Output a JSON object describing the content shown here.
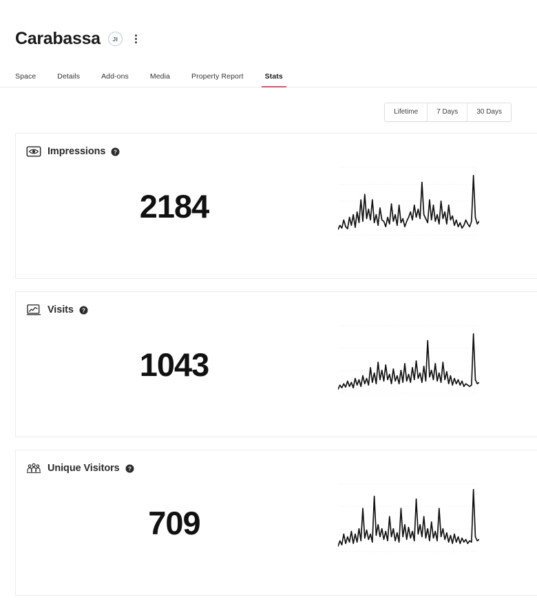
{
  "header": {
    "title": "Carabassa",
    "avatar_initials": "JI",
    "menu_icon": "kebab-menu-icon"
  },
  "tabs": [
    {
      "label": "Space",
      "active": false
    },
    {
      "label": "Details",
      "active": false
    },
    {
      "label": "Add-ons",
      "active": false
    },
    {
      "label": "Media",
      "active": false
    },
    {
      "label": "Property Report",
      "active": false
    },
    {
      "label": "Stats",
      "active": true
    }
  ],
  "range_selector": {
    "options": [
      "Lifetime",
      "7 Days",
      "30 Days"
    ],
    "selected": "Lifetime"
  },
  "colors": {
    "accent": "#d6546b",
    "avatar_border": "#b9c6e8",
    "text": "#1b1b1b",
    "card_border": "#ececec",
    "spark_line": "#111111",
    "gridline": "#eceef2"
  },
  "cards": [
    {
      "label": "Impressions",
      "icon": "impressions-eye-icon",
      "help_icon": "help-circle-icon",
      "value": "2184",
      "chart_data": {
        "type": "line",
        "title": "Impressions",
        "xlabel": "",
        "ylabel": "",
        "grid": true,
        "gridlines": 4,
        "ylim": [
          0,
          100
        ],
        "values": [
          8,
          14,
          10,
          22,
          12,
          9,
          26,
          14,
          30,
          11,
          34,
          18,
          52,
          20,
          60,
          24,
          38,
          22,
          52,
          18,
          30,
          14,
          40,
          22,
          20,
          12,
          26,
          16,
          46,
          20,
          30,
          14,
          44,
          18,
          24,
          12,
          20,
          26,
          34,
          22,
          44,
          26,
          38,
          24,
          78,
          30,
          24,
          18,
          52,
          22,
          44,
          20,
          30,
          16,
          50,
          24,
          34,
          16,
          44,
          22,
          28,
          14,
          22,
          12,
          18,
          10,
          14,
          22,
          16,
          12,
          20,
          88,
          26,
          16,
          20
        ]
      }
    },
    {
      "label": "Visits",
      "icon": "visits-linechart-icon",
      "help_icon": "help-circle-icon",
      "value": "1043",
      "chart_data": {
        "type": "line",
        "title": "Visits",
        "xlabel": "",
        "ylabel": "",
        "grid": true,
        "gridlines": 3,
        "ylim": [
          0,
          100
        ],
        "values": [
          6,
          12,
          8,
          14,
          9,
          18,
          10,
          16,
          8,
          22,
          12,
          20,
          10,
          26,
          14,
          22,
          12,
          38,
          16,
          30,
          14,
          46,
          20,
          34,
          18,
          42,
          20,
          28,
          14,
          36,
          18,
          26,
          14,
          34,
          16,
          44,
          18,
          28,
          16,
          38,
          20,
          48,
          22,
          30,
          16,
          40,
          18,
          78,
          24,
          34,
          20,
          44,
          18,
          30,
          16,
          46,
          20,
          32,
          14,
          26,
          12,
          22,
          14,
          20,
          12,
          18,
          10,
          14,
          12,
          10,
          12,
          88,
          20,
          14,
          16
        ]
      }
    },
    {
      "label": "Unique Visitors",
      "icon": "unique-visitors-people-icon",
      "help_icon": "help-circle-icon",
      "value": "709",
      "chart_data": {
        "type": "line",
        "title": "Unique Visitors",
        "xlabel": "",
        "ylabel": "",
        "grid": true,
        "gridlines": 3,
        "ylim": [
          0,
          100
        ],
        "values": [
          8,
          16,
          10,
          26,
          12,
          22,
          14,
          30,
          12,
          26,
          14,
          34,
          16,
          64,
          20,
          32,
          18,
          26,
          14,
          82,
          24,
          40,
          22,
          34,
          18,
          30,
          16,
          52,
          22,
          34,
          16,
          28,
          14,
          64,
          22,
          40,
          18,
          36,
          20,
          30,
          16,
          78,
          26,
          40,
          22,
          52,
          20,
          34,
          16,
          44,
          20,
          30,
          16,
          64,
          22,
          34,
          18,
          28,
          14,
          24,
          12,
          26,
          14,
          22,
          12,
          20,
          14,
          18,
          12,
          16,
          14,
          92,
          22,
          16,
          18
        ]
      }
    }
  ]
}
